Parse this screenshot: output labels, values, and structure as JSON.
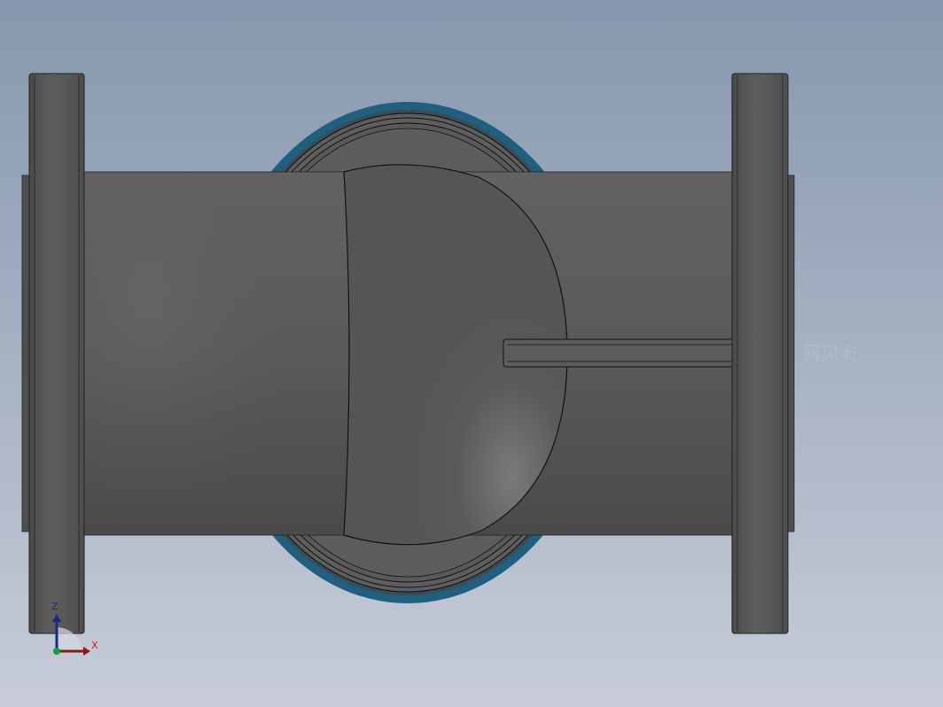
{
  "viewport": {
    "background_top": "#8797ad",
    "background_bottom": "#c7ccd8"
  },
  "model": {
    "part": "flanged-ball-valve-body",
    "body_color": "#5b5b5b",
    "flange_color": "#555555",
    "seal_ring_color": "#1f5f80",
    "edge_color": "#000000"
  },
  "watermark": {
    "text": "沐风网",
    "mirrored": true
  },
  "triad": {
    "z_label": "Z",
    "x_label": "X",
    "z_color": "#1a2a8a",
    "x_color": "#cc1a1a",
    "origin_color": "#1a9a3a"
  }
}
